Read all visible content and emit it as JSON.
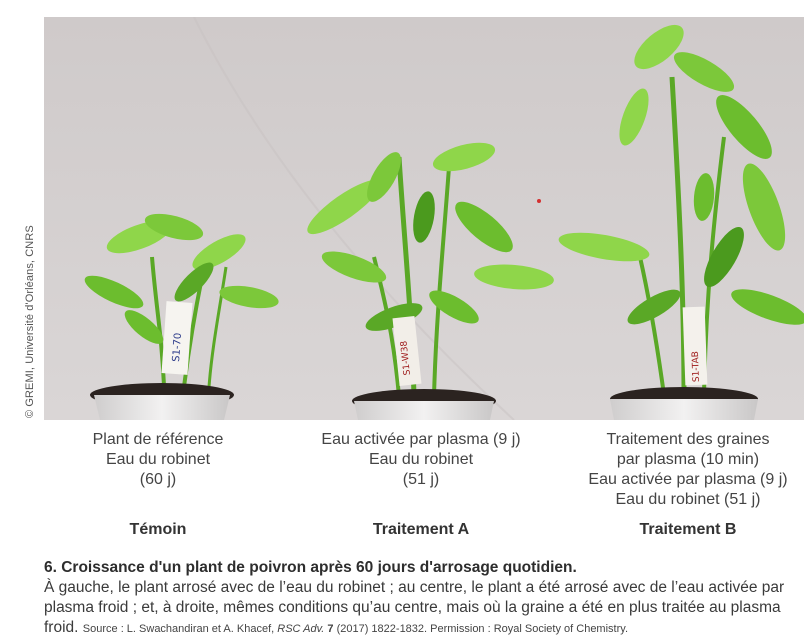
{
  "credit": "© GREMI, Université d'Orléans, CNRS",
  "columns": [
    {
      "lines": [
        "Plant de référence",
        "Eau du robinet",
        "(60 j)"
      ],
      "label": "Témoin"
    },
    {
      "lines": [
        "Eau activée par plasma (9 j)",
        "Eau du robinet",
        "(51 j)"
      ],
      "label": "Traitement A"
    },
    {
      "lines": [
        "Traitement des graines",
        "par plasma (10 min)",
        "Eau activée par plasma (9 j)",
        "Eau du robinet (51 j)"
      ],
      "label": "Traitement B"
    }
  ],
  "caption": {
    "title": "6. Croissance d'un plant de poivron après 60 jours d'arrosage quotidien.",
    "body": "À gauche, le plant arrosé avec de l’eau du robinet ; au centre, le plant a été arrosé avec de l’eau activée par plasma froid ; et, à droite, mêmes conditions qu’au centre, mais où la graine a été en plus traitée au plasma froid.",
    "source_prefix": "Source : L. Swachandiran et A. Khacef,",
    "journal": "RSC Adv.",
    "volume": "7",
    "source_suffix": "(2017) 1822-1832. Permission : Royal Society of Chemistry."
  },
  "labels": {
    "plant1_tag": "S1-70",
    "plant2_tag": "S1-W38",
    "plant3_tag": "S1-TAB"
  },
  "colors": {
    "background_wall": "#d3cfcf",
    "leaf_light": "#8fd64a",
    "leaf_mid": "#6cbd2e",
    "leaf_dark": "#4b9a1e",
    "soil": "#2b2320",
    "pot": "#e8e6e6"
  }
}
